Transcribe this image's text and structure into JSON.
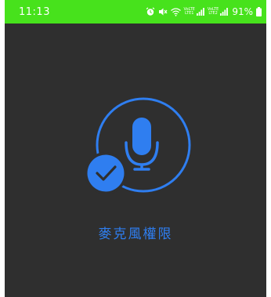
{
  "status_bar": {
    "time": "11:13",
    "volte_1_line1": "VoLTE",
    "volte_1_line2": "LTE1",
    "volte_2_line1": "VoLTE",
    "volte_2_line2": "LTE2",
    "battery": "91%",
    "background_color": "#47e21c",
    "icons": [
      "alarm-icon",
      "mute-icon",
      "wifi-icon",
      "signal-icon",
      "signal-icon",
      "battery-icon"
    ]
  },
  "permission": {
    "title": "麥克風權限",
    "icon": "microphone-icon",
    "check_icon": "checkmark-icon",
    "accent_color": "#2f7ef0"
  },
  "screen": {
    "background_color": "#2f2f2f"
  }
}
